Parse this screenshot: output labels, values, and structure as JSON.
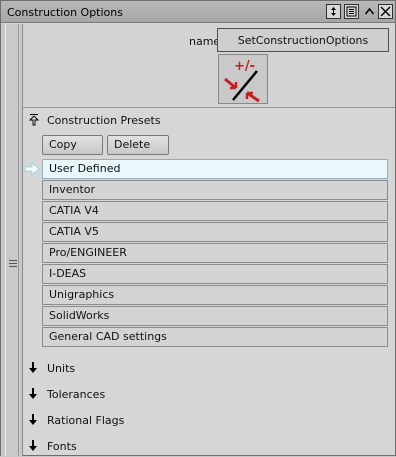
{
  "window": {
    "title": "Construction Options"
  },
  "form": {
    "name_label": "name",
    "name_value": "SetConstructionOptions"
  },
  "presets": {
    "header": "Construction Presets",
    "copy_label": "Copy",
    "delete_label": "Delete",
    "selected_index": 0,
    "items": [
      "User Defined",
      "Inventor",
      "CATIA V4",
      "CATIA V5",
      "Pro/ENGINEER",
      "I-DEAS",
      "Unigraphics",
      "SolidWorks",
      "General CAD settings"
    ]
  },
  "groups": [
    "Units",
    "Tolerances",
    "Rational Flags",
    "Fonts"
  ],
  "icons": {
    "title_buttons": [
      "resize-icon",
      "list-icon",
      "collapse-up-icon",
      "close-icon"
    ],
    "tool_icon": "construction-tool-icon",
    "colors": {
      "tool_icon_red": "#c41e1e",
      "selection_bg": "#e8f8fb"
    }
  }
}
